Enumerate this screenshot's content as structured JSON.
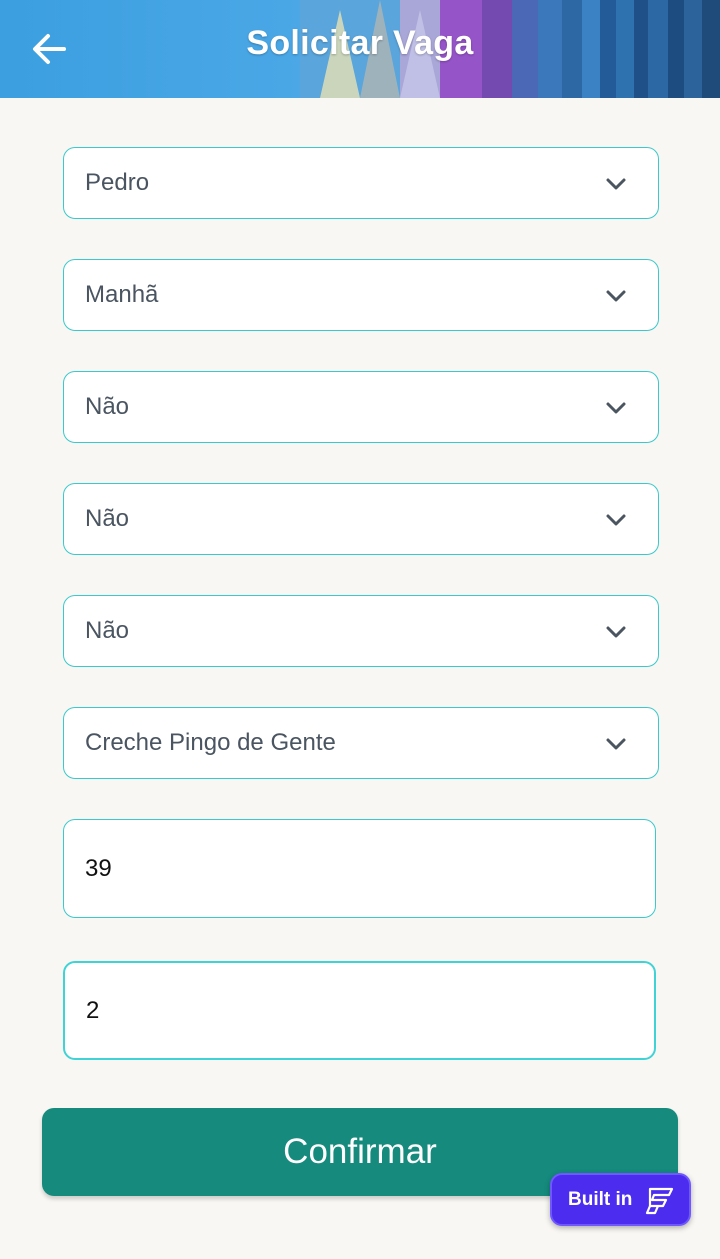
{
  "header": {
    "title": "Solicitar Vaga",
    "back_icon": "arrow-left-icon"
  },
  "form": {
    "selects": [
      {
        "value": "Pedro"
      },
      {
        "value": "Manhã"
      },
      {
        "value": "Não"
      },
      {
        "value": "Não"
      },
      {
        "value": "Não"
      },
      {
        "value": "Creche Pingo de Gente"
      }
    ],
    "inputs": [
      {
        "value": "39"
      },
      {
        "value": "2"
      }
    ],
    "confirm_label": "Confirmar"
  },
  "badge": {
    "label": "Built in",
    "icon": "flutterflow-logo-icon"
  },
  "colors": {
    "primary": "#158a7d",
    "field_border": "#3ac9cc",
    "background": "#f8f7f4",
    "badge": "#4c2df0"
  }
}
